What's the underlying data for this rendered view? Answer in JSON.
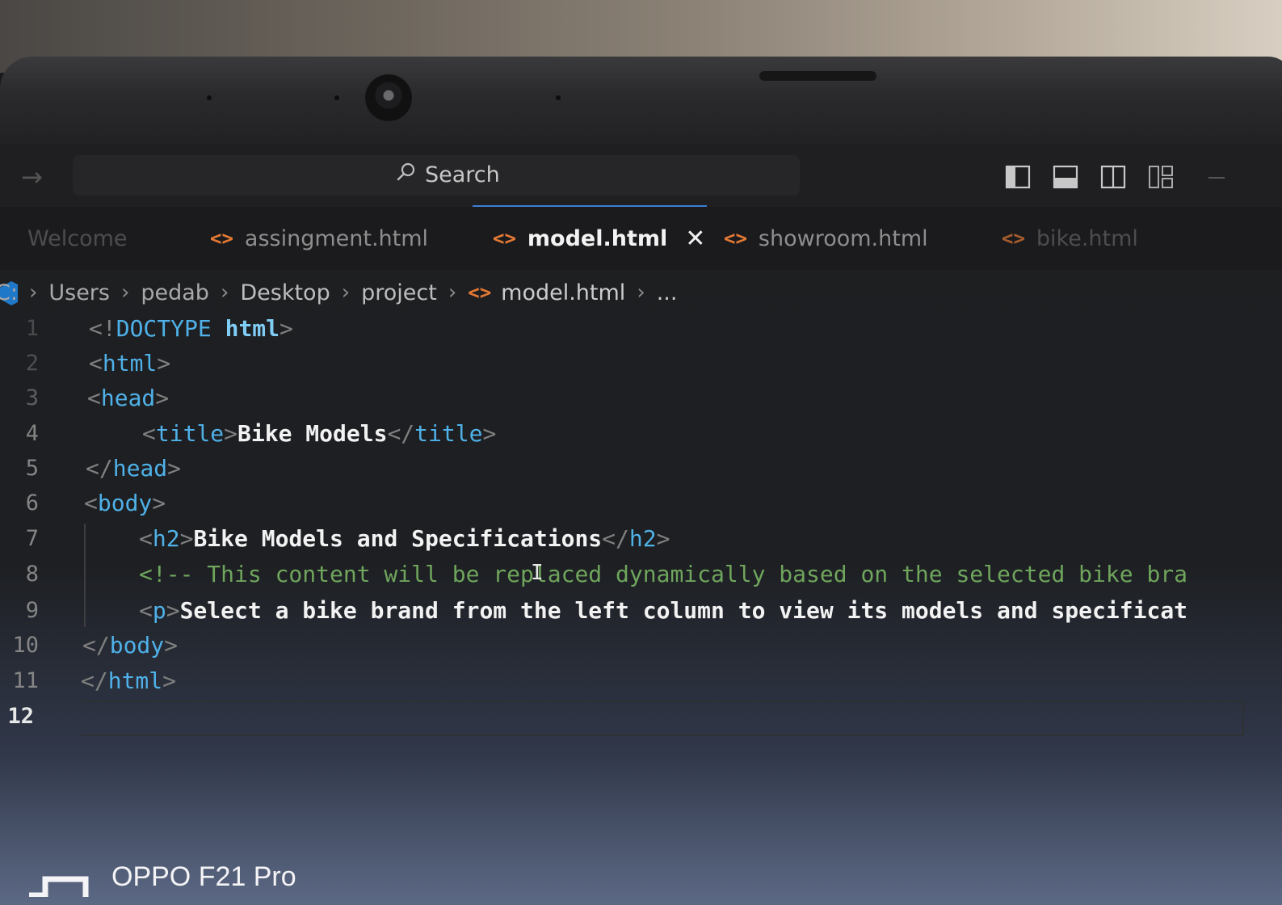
{
  "titlebar": {
    "search_label": "Search"
  },
  "tabs": [
    {
      "label": "Welcome",
      "icon": "vscode-logo-icon",
      "state": "faded"
    },
    {
      "label": "assingment.html",
      "icon": "html-tag-icon",
      "state": "inactive"
    },
    {
      "label": "model.html",
      "icon": "html-tag-icon",
      "state": "active"
    },
    {
      "label": "showroom.html",
      "icon": "html-tag-icon",
      "state": "inactive"
    },
    {
      "label": "bike.html",
      "icon": "html-tag-icon",
      "state": "faded"
    }
  ],
  "breadcrumb": {
    "drive": "C:",
    "parts": [
      "Users",
      "pedab",
      "Desktop",
      "project"
    ],
    "file": "model.html",
    "more": "..."
  },
  "editor": {
    "line_numbers": [
      "1",
      "2",
      "3",
      "4",
      "5",
      "6",
      "7",
      "8",
      "9",
      "10",
      "11",
      "12"
    ],
    "current_line": "12",
    "lines": {
      "l1_open": "<!",
      "l1_doctype": "DOCTYPE",
      "l1_html": "html",
      "l1_close": ">",
      "l2_tag": "html",
      "l3_tag": "head",
      "l4_tag_open": "title",
      "l4_text": "Bike Models",
      "l4_tag_close": "title",
      "l5_tag": "head",
      "l6_tag": "body",
      "l7_tag_open": "h2",
      "l7_text": "Bike Models and Specifications",
      "l7_tag_close": "h2",
      "l8_comment": "<!-- This content will be replaced dynamically based on the selected bike bra",
      "l9_tag": "p",
      "l9_text": "Select a bike brand from the left column to view its models and specificat",
      "l10_tag": "body",
      "l11_tag": "html"
    }
  },
  "overlay": {
    "watermark": "OPPO F21 Pro"
  },
  "colors": {
    "tag_blue": "#4fb1e8",
    "html_icon_orange": "#e37933",
    "comment_green": "#6fa55c",
    "search_progress_blue": "#3b7fd8"
  }
}
